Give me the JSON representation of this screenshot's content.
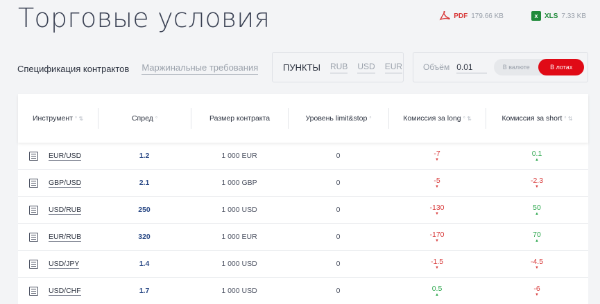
{
  "page": {
    "title": "Торговые условия"
  },
  "downloads": [
    {
      "label": "PDF",
      "size": "179.66 KB",
      "icon": "pdf-icon"
    },
    {
      "label": "XLS",
      "size": "7.33 KB",
      "icon": "xls-icon"
    }
  ],
  "tabs": [
    {
      "label": "Спецификация контрактов",
      "active": true
    },
    {
      "label": "Маржинальные требования",
      "active": false
    }
  ],
  "units": {
    "active": "ПУНКТЫ",
    "options": [
      "RUB",
      "USD",
      "EUR"
    ]
  },
  "volume": {
    "label": "Объём",
    "value": "0.01",
    "toggle_off": "В валюте",
    "toggle_on": "В лотах"
  },
  "colors": {
    "accent": "#e00a16",
    "negative": "#d83a3a",
    "positive": "#2fa84f",
    "spread": "#2b4a86"
  },
  "table": {
    "headers": [
      "Инструмент",
      "Спред",
      "Размер контракта",
      "Уровень limit&stop",
      "Комиссия за long",
      "Комиссия за short"
    ],
    "rows": [
      {
        "instrument": "EUR/USD",
        "spread": "1.2",
        "size": "1 000 EUR",
        "level": "0",
        "long": "-7",
        "long_dir": "down",
        "short": "0.1",
        "short_dir": "up"
      },
      {
        "instrument": "GBP/USD",
        "spread": "2.1",
        "size": "1 000 GBP",
        "level": "0",
        "long": "-5",
        "long_dir": "down",
        "short": "-2.3",
        "short_dir": "down"
      },
      {
        "instrument": "USD/RUB",
        "spread": "250",
        "size": "1 000 USD",
        "level": "0",
        "long": "-130",
        "long_dir": "down",
        "short": "50",
        "short_dir": "up"
      },
      {
        "instrument": "EUR/RUB",
        "spread": "320",
        "size": "1 000 EUR",
        "level": "0",
        "long": "-170",
        "long_dir": "down",
        "short": "70",
        "short_dir": "up"
      },
      {
        "instrument": "USD/JPY",
        "spread": "1.4",
        "size": "1 000 USD",
        "level": "0",
        "long": "-1.5",
        "long_dir": "down",
        "short": "-4.5",
        "short_dir": "down"
      },
      {
        "instrument": "USD/CHF",
        "spread": "1.7",
        "size": "1 000 USD",
        "level": "0",
        "long": "0.5",
        "long_dir": "up",
        "short": "-6",
        "short_dir": "down"
      }
    ]
  }
}
